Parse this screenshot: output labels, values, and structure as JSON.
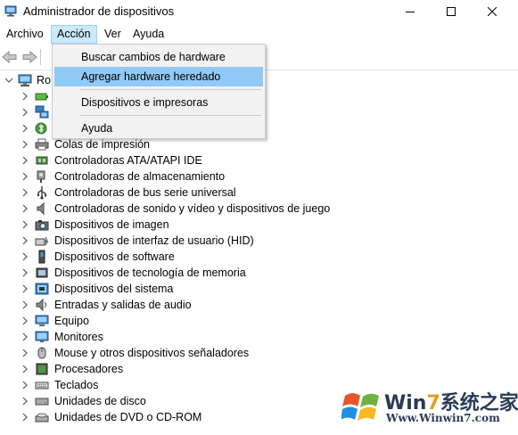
{
  "window": {
    "title": "Administrador de dispositivos"
  },
  "menu": {
    "items": [
      "Archivo",
      "Acción",
      "Ver",
      "Ayuda"
    ],
    "active_index": 1
  },
  "dropdown": {
    "items": [
      {
        "label": "Buscar cambios de hardware"
      },
      {
        "label": "Agregar hardware heredado",
        "highlighted": true
      },
      {
        "label": "Dispositivos e impresoras"
      },
      {
        "label": "Ayuda"
      }
    ]
  },
  "tree": {
    "root_label": "Ro",
    "categories": [
      {
        "label": "",
        "icon": "battery-icon"
      },
      {
        "label": "",
        "icon": "network-adapter-icon"
      },
      {
        "label": "",
        "icon": "bluetooth-icon"
      },
      {
        "label": "Colas de impresión",
        "icon": "printer-queue-icon"
      },
      {
        "label": "Controladoras ATA/ATAPI IDE",
        "icon": "ide-controller-icon"
      },
      {
        "label": "Controladoras de almacenamiento",
        "icon": "storage-controller-icon"
      },
      {
        "label": "Controladoras de bus serie universal",
        "icon": "usb-icon"
      },
      {
        "label": "Controladoras de sonido y vídeo y dispositivos de juego",
        "icon": "speaker-icon"
      },
      {
        "label": "Dispositivos de imagen",
        "icon": "camera-icon"
      },
      {
        "label": "Dispositivos de interfaz de usuario (HID)",
        "icon": "hid-icon"
      },
      {
        "label": "Dispositivos de software",
        "icon": "software-device-icon"
      },
      {
        "label": "Dispositivos de tecnología de memoria",
        "icon": "memory-icon"
      },
      {
        "label": "Dispositivos del sistema",
        "icon": "system-device-icon"
      },
      {
        "label": "Entradas y salidas de audio",
        "icon": "audio-io-icon"
      },
      {
        "label": "Equipo",
        "icon": "computer-icon"
      },
      {
        "label": "Monitores",
        "icon": "monitor-icon"
      },
      {
        "label": "Mouse y otros dispositivos señaladores",
        "icon": "mouse-icon"
      },
      {
        "label": "Procesadores",
        "icon": "processor-icon"
      },
      {
        "label": "Teclados",
        "icon": "keyboard-icon"
      },
      {
        "label": "Unidades de disco",
        "icon": "disk-drive-icon"
      },
      {
        "label": "Unidades de DVD o CD-ROM",
        "icon": "dvd-drive-icon"
      }
    ]
  },
  "watermark": {
    "brand_prefix": "Win",
    "brand_seven": "7",
    "brand_suffix": "系统之家",
    "url": "Www.Winwin7.com"
  },
  "colors": {
    "menu_highlight": "#91c9f7",
    "menu_active_bg": "#cce8ff",
    "menu_bg": "#f2f2f2"
  }
}
